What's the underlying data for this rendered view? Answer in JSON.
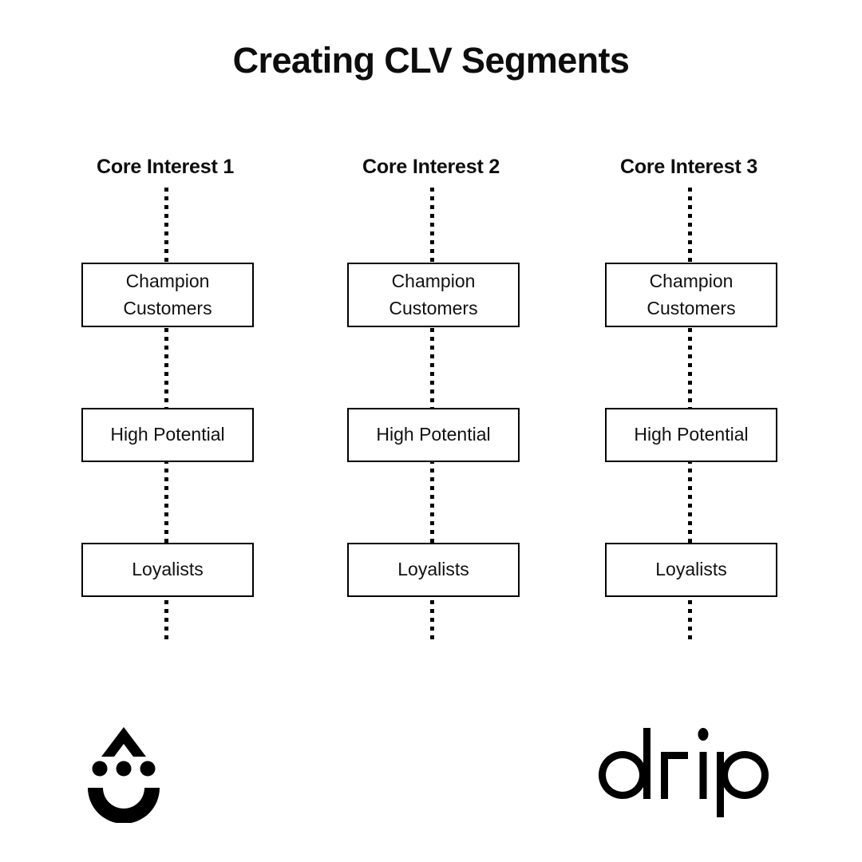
{
  "title": "Creating CLV Segments",
  "background_color": "#ffffff",
  "ink_color": "#000000",
  "columns": [
    {
      "header": "Core Interest 1",
      "nodes": [
        {
          "label": "Champion\nCustomers"
        },
        {
          "label": "High Potential"
        },
        {
          "label": "Loyalists"
        }
      ]
    },
    {
      "header": "Core Interest 2",
      "nodes": [
        {
          "label": "Champion\nCustomers"
        },
        {
          "label": "High Potential"
        },
        {
          "label": "Loyalists"
        }
      ]
    },
    {
      "header": "Core Interest 3",
      "nodes": [
        {
          "label": "Champion\nCustomers"
        },
        {
          "label": "High Potential"
        },
        {
          "label": "Loyalists"
        }
      ]
    }
  ],
  "branding": {
    "mark_name": "drip-smiley-logo",
    "wordmark_name": "drip-wordmark",
    "wordmark_text": "drip"
  }
}
